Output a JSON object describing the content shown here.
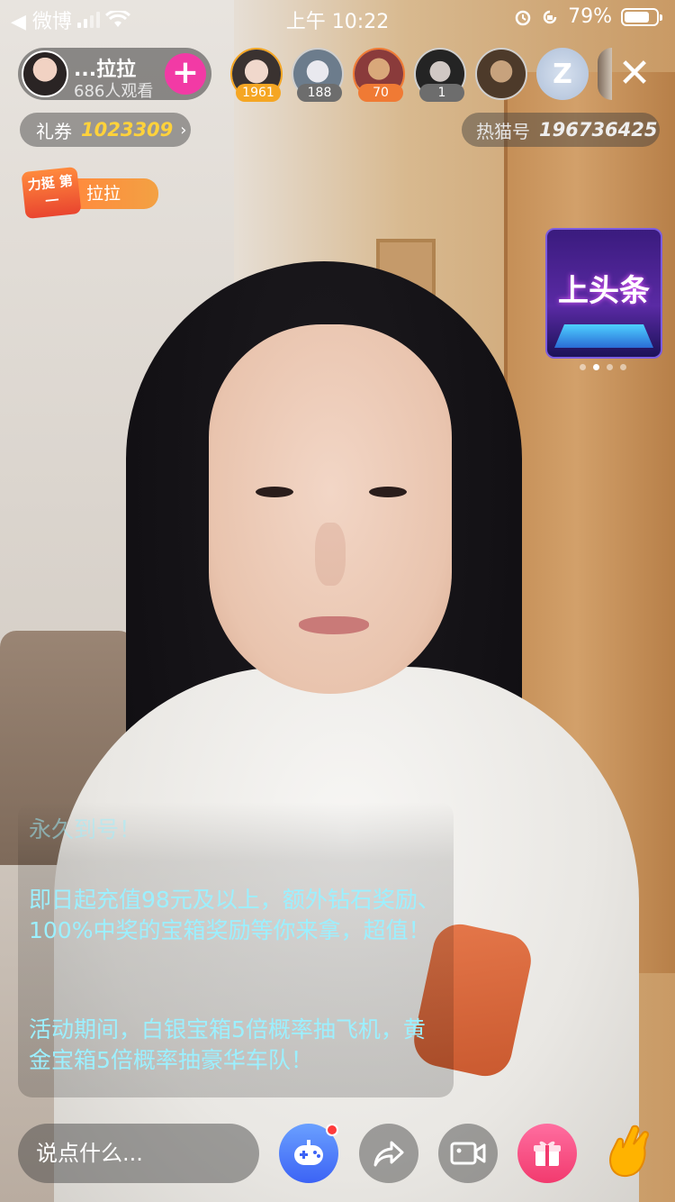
{
  "status_bar": {
    "back_app": "◀ 微博",
    "time": "上午 10:22",
    "battery": "79%",
    "battery_level": 0.79
  },
  "host": {
    "name": "...拉拉",
    "viewers": "686人观看",
    "follow_label": "+"
  },
  "viewers": [
    {
      "badge": "1961",
      "badge_color": "#f5a623"
    },
    {
      "badge": "188",
      "badge_color": "#6d6d6d"
    },
    {
      "badge": "70",
      "badge_color": "#f07a34"
    },
    {
      "badge": "1",
      "badge_color": "#6d6d6d"
    },
    {
      "badge": "",
      "badge_color": ""
    }
  ],
  "rank_icon": "Z",
  "close_label": "✕",
  "coupon": {
    "label": "礼券",
    "value": "1023309",
    "arrow": "›"
  },
  "room_id": {
    "label": "热猫号",
    "value": "196736425"
  },
  "honor_badge": {
    "shield_text": "力挺 第一",
    "name": "拉拉"
  },
  "headline_card": {
    "text": "上头条"
  },
  "chat": {
    "faded_line": "永久到号！",
    "paragraph1": "即日起充值98元及以上，额外钻石奖励、100%中奖的宝箱奖励等你来拿，超值！",
    "paragraph2": "活动期间，白银宝箱5倍概率抽飞机，黄金宝箱5倍概率抽豪华车队！"
  },
  "input": {
    "placeholder": "说点什么..."
  },
  "colors": {
    "accent": "#f23aa5",
    "coupon_value": "#ffd23b",
    "chat_text": "#9cf0ff"
  }
}
